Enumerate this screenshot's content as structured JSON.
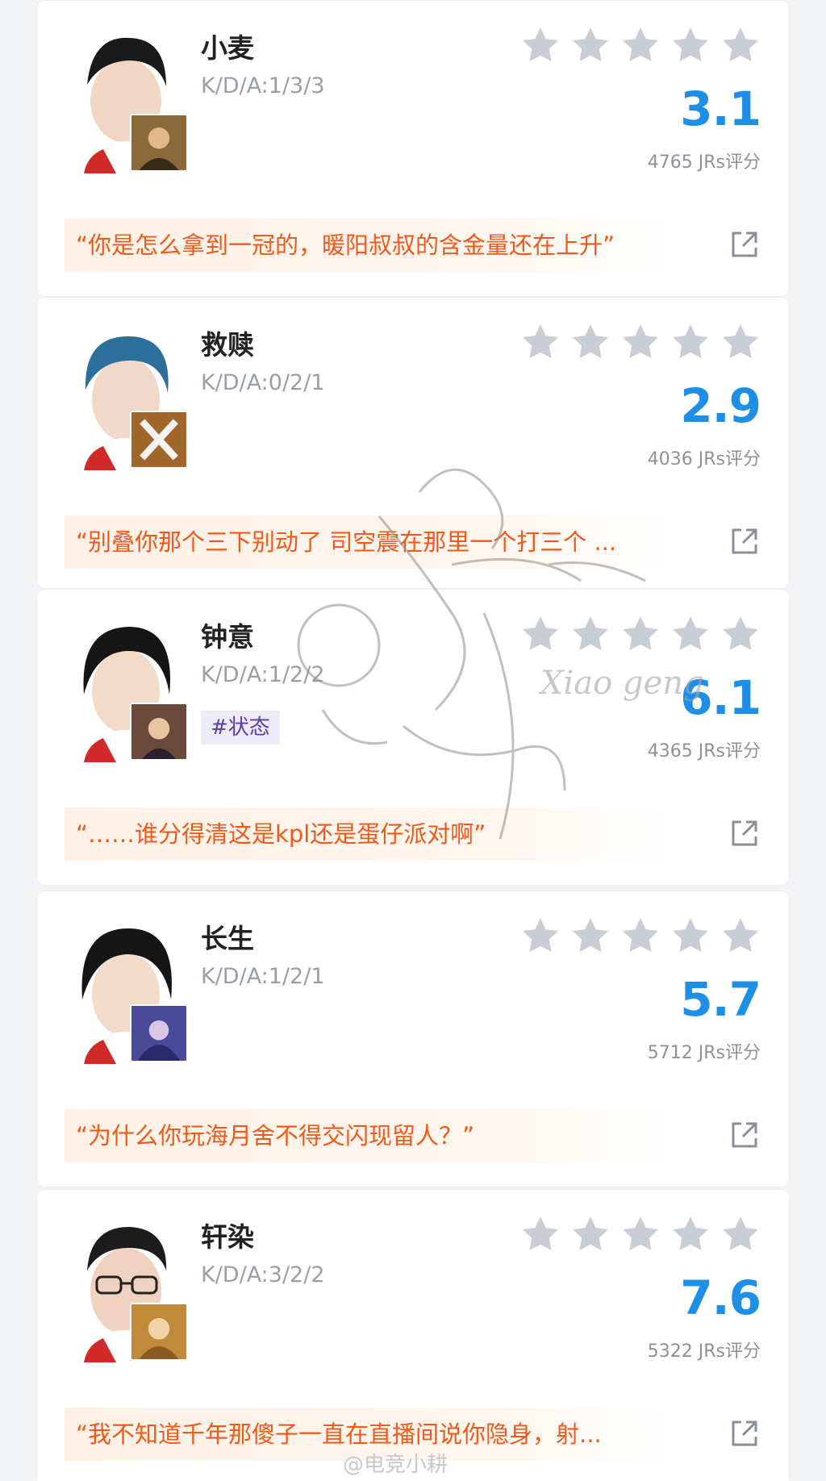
{
  "players": [
    {
      "name": "小麦",
      "kda": "K/D/A:1/3/3",
      "score": "3.1",
      "ratings": "4765 JRs评分",
      "quote": "“你是怎么拿到一冠的，暖阳叔叔的含金量还在上升”",
      "tag": "",
      "hero_color": "#8a6a3a",
      "hair_color": "#1a1a1a"
    },
    {
      "name": "救赎",
      "kda": "K/D/A:0/2/1",
      "score": "2.9",
      "ratings": "4036 JRs评分",
      "quote": "“别叠你那个三下别动了 司空震在那里一个打三个 ...",
      "tag": "",
      "hero_color": "#a0672a",
      "hair_color": "#2b6f9a"
    },
    {
      "name": "钟意",
      "kda": "K/D/A:1/2/2",
      "score": "6.1",
      "ratings": "4365 JRs评分",
      "quote": "“……谁分得清这是kpl还是蛋仔派对啊”",
      "tag": "#状态",
      "hero_color": "#6a4a3a",
      "hair_color": "#151515"
    },
    {
      "name": "长生",
      "kda": "K/D/A:1/2/1",
      "score": "5.7",
      "ratings": "5712 JRs评分",
      "quote": "“为什么你玩海月舍不得交闪现留人？”",
      "tag": "",
      "hero_color": "#4a4a9a",
      "hair_color": "#151515"
    },
    {
      "name": "轩染",
      "kda": "K/D/A:3/2/2",
      "score": "7.6",
      "ratings": "5322 JRs评分",
      "quote": "“我不知道千年那傻子一直在直播间说你隐身，射...",
      "tag": "",
      "hero_color": "#c08a3a",
      "hair_color": "#1c1c1c"
    }
  ],
  "watermark": {
    "text": "Xiao geng",
    "weibo": "@电竞小耕"
  },
  "colors": {
    "score": "#1e8fe6",
    "quote": "#ef5a1a",
    "star": "#c9cdd6",
    "tag_text": "#5a3ea6"
  }
}
